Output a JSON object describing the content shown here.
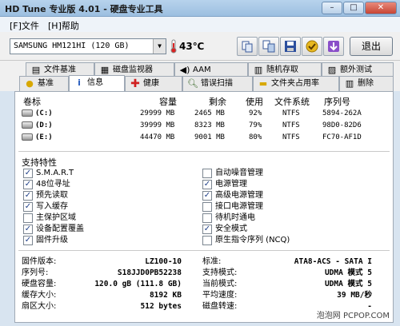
{
  "window": {
    "title": "HD Tune 专业版 4.01 - 硬盘专业工具"
  },
  "menu": [
    "[F]文件",
    "[H]帮助"
  ],
  "toolbar": {
    "drive": "SAMSUNG HM121HI (120 GB)",
    "temperature": "43℃",
    "exit_label": "退出",
    "icons": [
      "copy-icon",
      "copy-all-icon",
      "save-icon",
      "options-icon",
      "download-icon"
    ]
  },
  "tabs_row1": [
    "文件基准",
    "磁盘监视器",
    "AAM",
    "随机存取",
    "额外测试"
  ],
  "tabs_row2": [
    "基准",
    "信息",
    "健康",
    "错误扫描",
    "文件夹占用率",
    "删除"
  ],
  "volumes": {
    "headers": [
      "卷标",
      "容量",
      "剩余",
      "使用",
      "文件系统",
      "序列号"
    ],
    "rows": [
      [
        "(C:)",
        "29999 MB",
        "2465 MB",
        "92%",
        "NTFS",
        "5894-262A"
      ],
      [
        "(D:)",
        "39999 MB",
        "8323 MB",
        "79%",
        "NTFS",
        "98D0-82D6"
      ],
      [
        "(E:)",
        "44470 MB",
        "9001 MB",
        "80%",
        "NTFS",
        "FC70-AF1D"
      ]
    ]
  },
  "features": {
    "title": "支持特性",
    "left": [
      {
        "label": "S.M.A.R.T",
        "checked": true
      },
      {
        "label": "48位寻址",
        "checked": true
      },
      {
        "label": "预先读取",
        "checked": true
      },
      {
        "label": "写入缓存",
        "checked": true
      },
      {
        "label": "主保护区域",
        "checked": false
      },
      {
        "label": "设备配置覆盖",
        "checked": true
      },
      {
        "label": "固件升级",
        "checked": true
      }
    ],
    "right": [
      {
        "label": "自动噪音管理",
        "checked": false
      },
      {
        "label": "电源管理",
        "checked": true
      },
      {
        "label": "高级电源管理",
        "checked": true
      },
      {
        "label": "接口电源管理",
        "checked": false
      },
      {
        "label": "待机时通电",
        "checked": false
      },
      {
        "label": "安全模式",
        "checked": true
      },
      {
        "label": "原生指令序列 (NCQ)",
        "checked": false
      }
    ]
  },
  "info": {
    "left": [
      {
        "label": "固件版本:",
        "value": "LZ100-10"
      },
      {
        "label": "序列号:",
        "value": "S18JJD0PB52238"
      },
      {
        "label": "硬盘容量:",
        "value": "120.0 gB (111.8 GB)"
      },
      {
        "label": "缓存大小:",
        "value": "8192 KB"
      },
      {
        "label": "扇区大小:",
        "value": "512 bytes"
      }
    ],
    "right": [
      {
        "label": "标准:",
        "value": "ATA8-ACS - SATA I"
      },
      {
        "label": "支持模式:",
        "value": "UDMA 模式 5"
      },
      {
        "label": "当前模式:",
        "value": "UDMA 模式 5"
      },
      {
        "label": "平均速度:",
        "value": "39 MB/秒"
      },
      {
        "label": "磁盘转速:",
        "value": "-"
      }
    ]
  },
  "watermark": "泡泡网 PCPOP.COM"
}
